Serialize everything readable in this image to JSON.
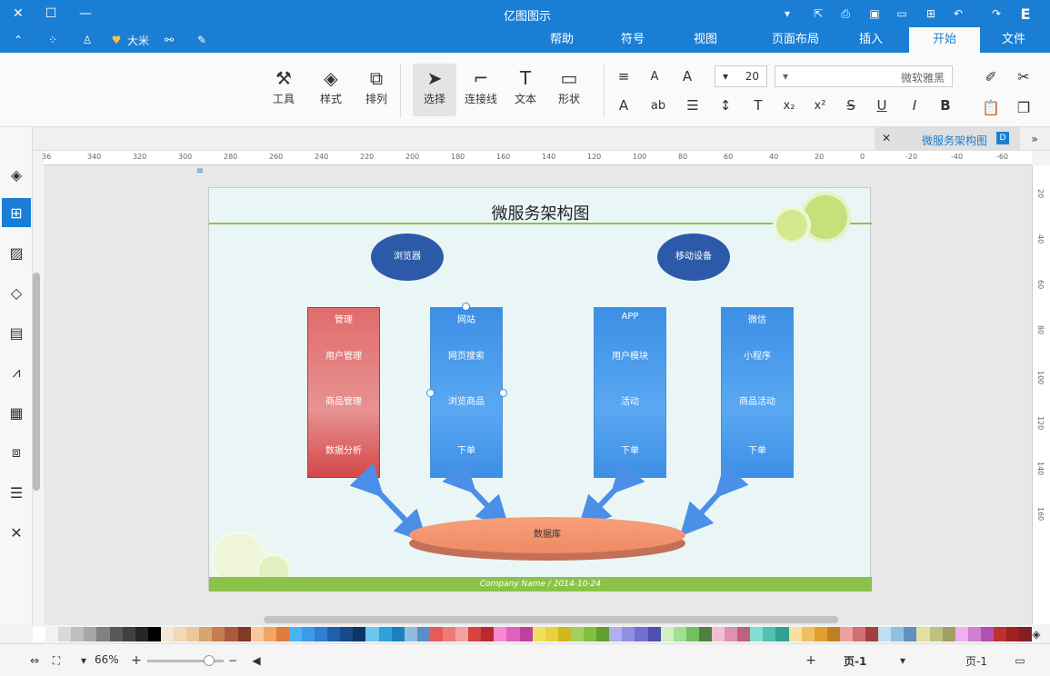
{
  "titlebar": {
    "title": "亿图图示"
  },
  "menu": {
    "tabs": [
      {
        "label": "文件"
      },
      {
        "label": "开始"
      },
      {
        "label": "插入"
      },
      {
        "label": "页面布局"
      },
      {
        "label": "视图"
      },
      {
        "label": "符号"
      },
      {
        "label": "帮助"
      }
    ],
    "user": "大米"
  },
  "ribbon": {
    "font_name": "微软雅黑",
    "font_size": "20",
    "buttons": [
      {
        "label": "形状"
      },
      {
        "label": "文本"
      },
      {
        "label": "连接线"
      },
      {
        "label": "选择"
      },
      {
        "label": "排列"
      },
      {
        "label": "样式"
      },
      {
        "label": "工具"
      }
    ]
  },
  "doc_tab": {
    "title": "微服务架构图"
  },
  "ruler": {
    "top_ticks": [
      "-60",
      "-40",
      "-20",
      "0",
      "20",
      "40",
      "60",
      "80",
      "100",
      "120",
      "140",
      "160",
      "180",
      "200",
      "220",
      "240",
      "260",
      "280",
      "300",
      "320",
      "340",
      "36"
    ],
    "right_ticks": [
      "20",
      "40",
      "60",
      "80",
      "100",
      "120",
      "140",
      "160"
    ]
  },
  "diagram": {
    "title": "微服务架构图",
    "ellipse_left": "浏览器",
    "ellipse_right": "移动设备",
    "columns": [
      {
        "header": "管理",
        "items": [
          "用户管理",
          "商品管理",
          "数据分析"
        ],
        "color": "#d9534f"
      },
      {
        "header": "网站",
        "items": [
          "网页搜索",
          "浏览商品",
          "下单"
        ],
        "color": "#3d8fe6"
      },
      {
        "header": "APP",
        "items": [
          "用户模块",
          "活动",
          "下单"
        ],
        "color": "#3d8fe6"
      },
      {
        "header": "微信",
        "items": [
          "小程序",
          "商品活动",
          "下单"
        ],
        "color": "#3d8fe6"
      }
    ],
    "database": "数据库",
    "footer": "Company Name / 2014-10-24"
  },
  "status": {
    "page_label": "页-1",
    "page_tab": "页-1",
    "zoom": "66%"
  },
  "palette": [
    "#ffffff",
    "#f2f2f2",
    "#d9d9d9",
    "#bfbfbf",
    "#a6a6a6",
    "#808080",
    "#595959",
    "#404040",
    "#262626",
    "#000000",
    "#f5e6d3",
    "#f0d9b5",
    "#e8c99a",
    "#d9a56e",
    "#c97b4f",
    "#a85a3a",
    "#7f3b26",
    "#f8c8a0",
    "#f4a460",
    "#e07b39",
    "#4ab3f4",
    "#3d9be9",
    "#2f7fd3",
    "#1f5fb0",
    "#164a8a",
    "#0d3566",
    "#6ec6f0",
    "#2ea0dc",
    "#1b7fc0",
    "#8fbde0",
    "#5a8ec8",
    "#e85a5a",
    "#f07a7a",
    "#f5a0a0",
    "#d94040",
    "#b82a2a",
    "#f58ad0",
    "#e060c0",
    "#c040a0",
    "#f0e060",
    "#e8d040",
    "#d0b820",
    "#a0d060",
    "#80c040",
    "#60a030",
    "#b0b0f0",
    "#9090e0",
    "#7070d0",
    "#5050b0",
    "#d0f0c0",
    "#a0e090",
    "#70c060",
    "#508040",
    "#f0c0d0",
    "#e090b0",
    "#c06080",
    "#80e0d0",
    "#50c0b0",
    "#30a090",
    "#f8e0a0",
    "#f0c060",
    "#e0a030",
    "#c08020",
    "#f0a0a0",
    "#d07070",
    "#a04040",
    "#c0e0f0",
    "#90c0e0",
    "#6090c0",
    "#e0e0a0",
    "#c0c080",
    "#a0a060",
    "#f0b0f0",
    "#d080d0",
    "#b050b0",
    "#c03030",
    "#a02020",
    "#802020"
  ]
}
